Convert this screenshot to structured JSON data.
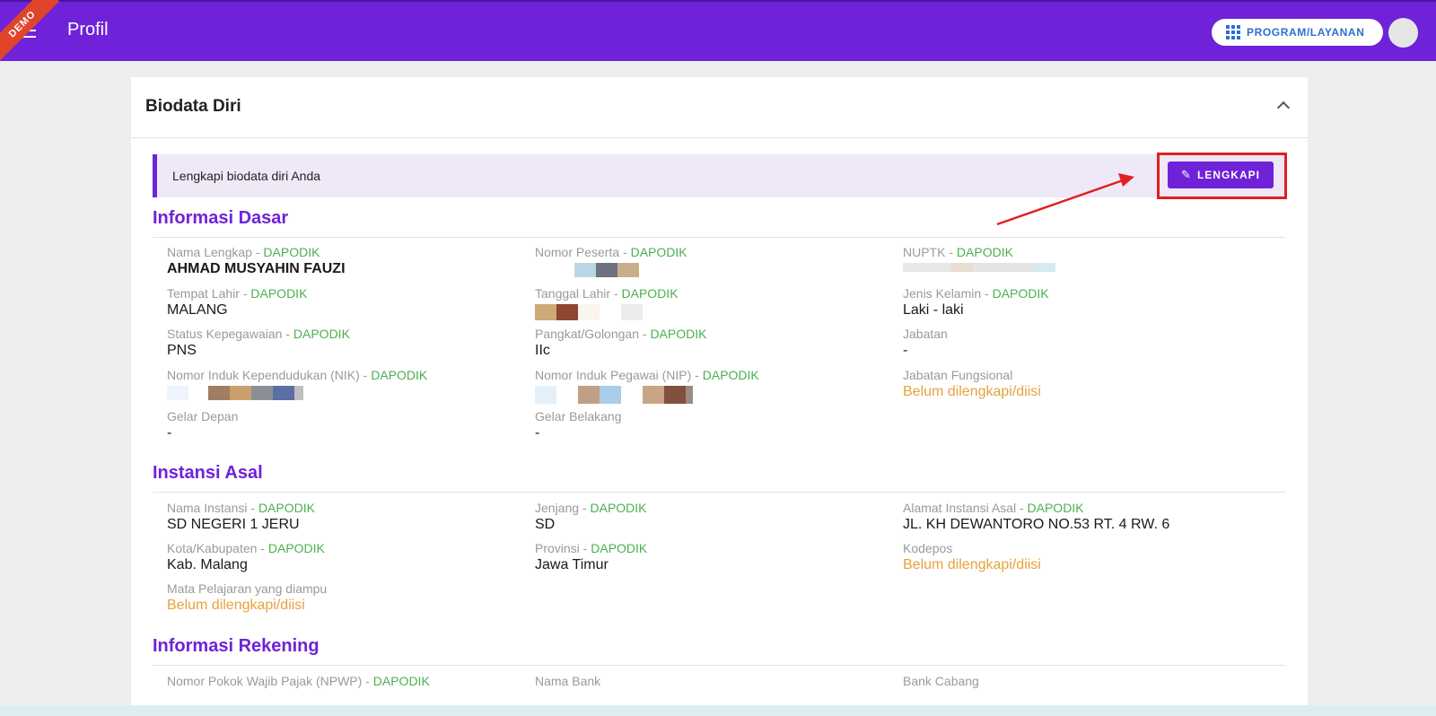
{
  "header": {
    "demo_ribbon": "DEMO",
    "title": "Profil",
    "program_button": "PROGRAM/LAYANAN",
    "menu_icon": "hamburger-icon",
    "program_icon": "grid-icon"
  },
  "card": {
    "title": "Biodata Diri",
    "alert_text": "Lengkapi biodata diri Anda",
    "lengkapi_button": "LENGKAPI"
  },
  "sections": {
    "informasi_dasar": {
      "title": "Informasi Dasar",
      "nama_lengkap": {
        "label": "Nama Lengkap",
        "source": "DAPODIK",
        "value": "AHMAD MUSYAHIN FAUZI"
      },
      "nomor_peserta": {
        "label": "Nomor Peserta",
        "source": "DAPODIK"
      },
      "nuptk": {
        "label": "NUPTK",
        "source": "DAPODIK"
      },
      "tempat_lahir": {
        "label": "Tempat Lahir",
        "source": "DAPODIK",
        "value": "MALANG"
      },
      "tanggal_lahir": {
        "label": "Tanggal Lahir",
        "source": "DAPODIK"
      },
      "jenis_kelamin": {
        "label": "Jenis Kelamin",
        "source": "DAPODIK",
        "value": "Laki - laki"
      },
      "status_kepegawaian": {
        "label": "Status Kepegawaian",
        "source": "DAPODIK",
        "value": "PNS"
      },
      "pangkat": {
        "label": "Pangkat/Golongan",
        "source": "DAPODIK",
        "value": "IIc"
      },
      "jabatan": {
        "label": "Jabatan",
        "value": "-"
      },
      "nik": {
        "label": "Nomor Induk Kependudukan (NIK)",
        "source": "DAPODIK"
      },
      "nip": {
        "label": "Nomor Induk Pegawai (NIP)",
        "source": "DAPODIK"
      },
      "jabatan_fungsional": {
        "label": "Jabatan Fungsional",
        "value": "Belum dilengkapi/diisi"
      },
      "gelar_depan": {
        "label": "Gelar Depan",
        "value": "-"
      },
      "gelar_belakang": {
        "label": "Gelar Belakang",
        "value": "-"
      }
    },
    "instansi_asal": {
      "title": "Instansi Asal",
      "nama_instansi": {
        "label": "Nama Instansi",
        "source": "DAPODIK",
        "value": "SD NEGERI 1 JERU"
      },
      "jenjang": {
        "label": "Jenjang",
        "source": "DAPODIK",
        "value": "SD"
      },
      "alamat": {
        "label": "Alamat Instansi Asal",
        "source": "DAPODIK",
        "value": "JL. KH DEWANTORO NO.53 RT. 4 RW. 6"
      },
      "kota": {
        "label": "Kota/Kabupaten",
        "source": "DAPODIK",
        "value": "Kab. Malang"
      },
      "provinsi": {
        "label": "Provinsi",
        "source": "DAPODIK",
        "value": "Jawa Timur"
      },
      "kodepos": {
        "label": "Kodepos",
        "value": "Belum dilengkapi/diisi"
      },
      "mapel": {
        "label": "Mata Pelajaran yang diampu",
        "value": "Belum dilengkapi/diisi"
      }
    },
    "informasi_rekening": {
      "title": "Informasi Rekening",
      "npwp": {
        "label": "Nomor Pokok Wajib Pajak (NPWP)",
        "source": "DAPODIK"
      },
      "nama_bank": {
        "label": "Nama Bank"
      },
      "bank_cabang": {
        "label": "Bank Cabang"
      }
    }
  },
  "colors": {
    "brand": "#6f22d8",
    "source": "#4caf50",
    "warning": "#e6a23c",
    "highlight": "#e02020"
  }
}
